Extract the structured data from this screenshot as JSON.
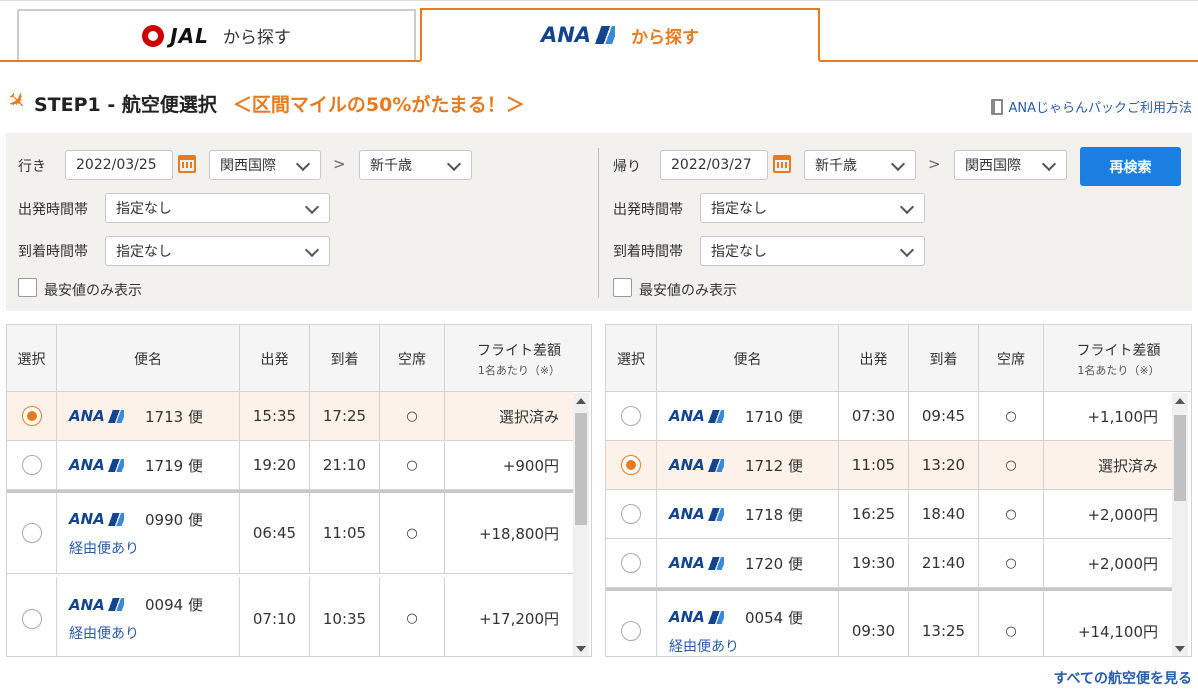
{
  "tabs": {
    "jal": {
      "brand": "JAL",
      "label": "から探す"
    },
    "ana": {
      "brand": "ANA",
      "label": "から探す"
    }
  },
  "step": {
    "title": "STEP1 - 航空便選択",
    "promo": "＜区間マイルの50%がたまる！＞",
    "pack_link": "ANAじゃらんパックご利用方法"
  },
  "outbound": {
    "label": "行き",
    "date": "2022/03/25",
    "from": "関西国際",
    "to": "新千歳",
    "depart_time_label": "出発時間帯",
    "depart_time": "指定なし",
    "arrive_time_label": "到着時間帯",
    "arrive_time": "指定なし",
    "cheapest_label": "最安値のみ表示"
  },
  "return": {
    "label": "帰り",
    "date": "2022/03/27",
    "from": "新千歳",
    "to": "関西国際",
    "depart_time_label": "出発時間帯",
    "depart_time": "指定なし",
    "arrive_time_label": "到着時間帯",
    "arrive_time": "指定なし",
    "cheapest_label": "最安値のみ表示"
  },
  "search_button": "再検索",
  "gt_symbol": ">",
  "table_headers": {
    "select": "選択",
    "flight": "便名",
    "depart": "出発",
    "arrive": "到着",
    "seats": "空席",
    "diff": "フライト差額",
    "diff_sub": "1名あたり（※）"
  },
  "outbound_flights": [
    {
      "brand": "ANA",
      "number": "1713 便",
      "depart": "15:35",
      "arrive": "17:25",
      "seat": "○",
      "price": "選択済み",
      "selected": true,
      "via": ""
    },
    {
      "brand": "ANA",
      "number": "1719 便",
      "depart": "19:20",
      "arrive": "21:10",
      "seat": "○",
      "price": "+900円",
      "selected": false,
      "via": ""
    },
    {
      "brand": "ANA",
      "number": "0990 便",
      "depart": "06:45",
      "arrive": "11:05",
      "seat": "○",
      "price": "+18,800円",
      "selected": false,
      "via": "経由便あり"
    },
    {
      "brand": "ANA",
      "number": "0094 便",
      "depart": "07:10",
      "arrive": "10:35",
      "seat": "○",
      "price": "+17,200円",
      "selected": false,
      "via": "経由便あり"
    }
  ],
  "return_flights": [
    {
      "brand": "ANA",
      "number": "1710 便",
      "depart": "07:30",
      "arrive": "09:45",
      "seat": "○",
      "price": "+1,100円",
      "selected": false,
      "via": ""
    },
    {
      "brand": "ANA",
      "number": "1712 便",
      "depart": "11:05",
      "arrive": "13:20",
      "seat": "○",
      "price": "選択済み",
      "selected": true,
      "via": ""
    },
    {
      "brand": "ANA",
      "number": "1718 便",
      "depart": "16:25",
      "arrive": "18:40",
      "seat": "○",
      "price": "+2,000円",
      "selected": false,
      "via": ""
    },
    {
      "brand": "ANA",
      "number": "1720 便",
      "depart": "19:30",
      "arrive": "21:40",
      "seat": "○",
      "price": "+2,000円",
      "selected": false,
      "via": ""
    },
    {
      "brand": "ANA",
      "number": "0054 便",
      "depart": "09:30",
      "arrive": "13:25",
      "seat": "○",
      "price": "+14,100円",
      "selected": false,
      "via": "経由便あり"
    }
  ],
  "all_flights_link": "すべての航空便を見る",
  "colors": {
    "accent": "#e87b1f",
    "ana_blue": "#13448f",
    "button": "#1a7fe0",
    "link": "#2a5caa"
  }
}
